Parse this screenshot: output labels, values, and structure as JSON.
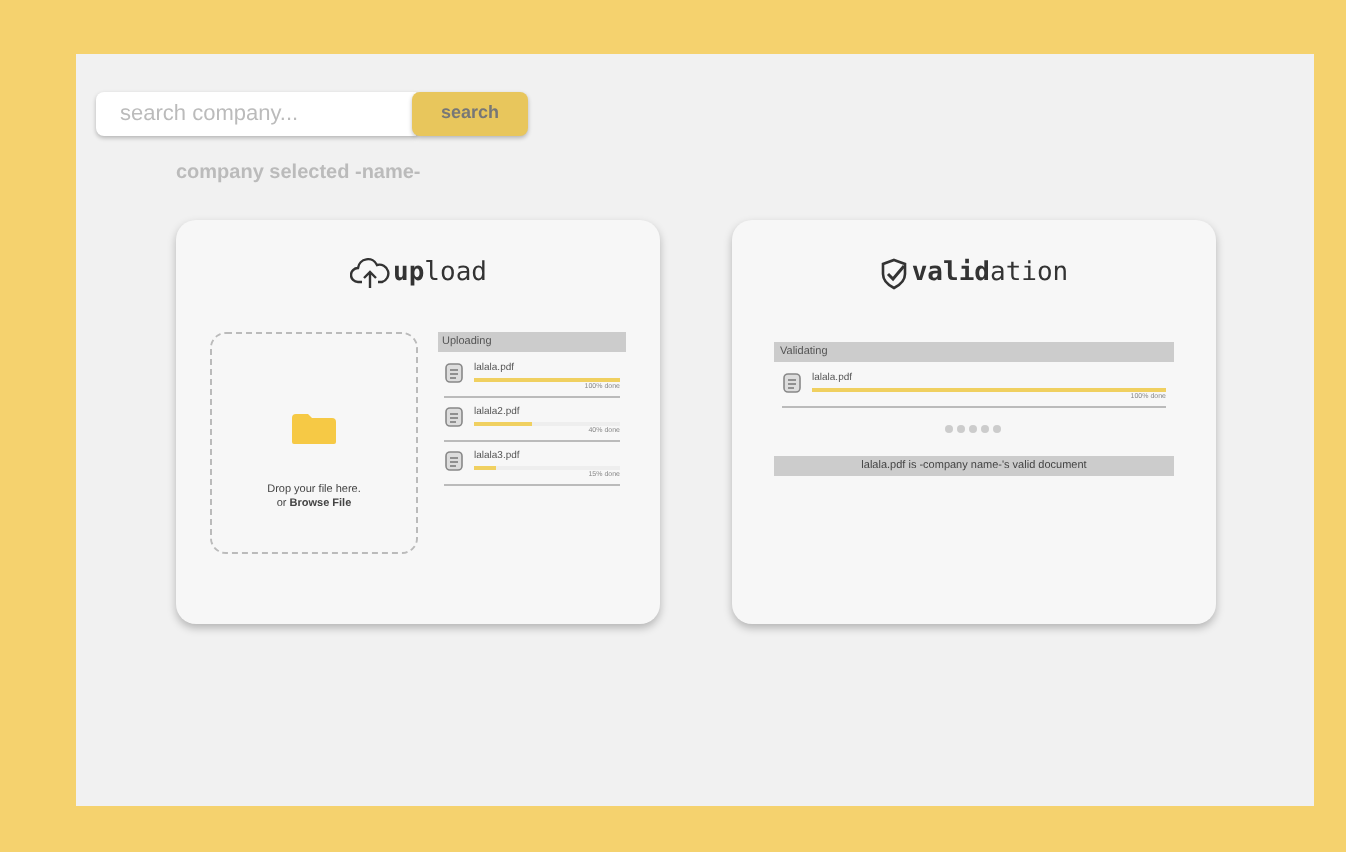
{
  "search": {
    "placeholder": "search company...",
    "button": "search"
  },
  "selected_company": "company selected -name-",
  "upload": {
    "title": "**up**load",
    "dropzone": {
      "line1": "Drop your file here.",
      "line2": "or **Browse File**"
    },
    "list_header": "Uploading",
    "files": [
      {
        "name": "lalala.pdf",
        "level": 1.0,
        "status": "100% done"
      },
      {
        "name": "lalala2.pdf",
        "level": 0.4,
        "status": "40% done"
      },
      {
        "name": "lalala3.pdf",
        "level": 0.15,
        "status": "15% done"
      }
    ]
  },
  "validation": {
    "title": "**valid**ation",
    "list_header": "Validating",
    "files": [
      {
        "name": "lalala.pdf",
        "level": 1.0,
        "status": "100% done"
      }
    ],
    "result": "lalala.pdf is -company name-'s valid document"
  }
}
